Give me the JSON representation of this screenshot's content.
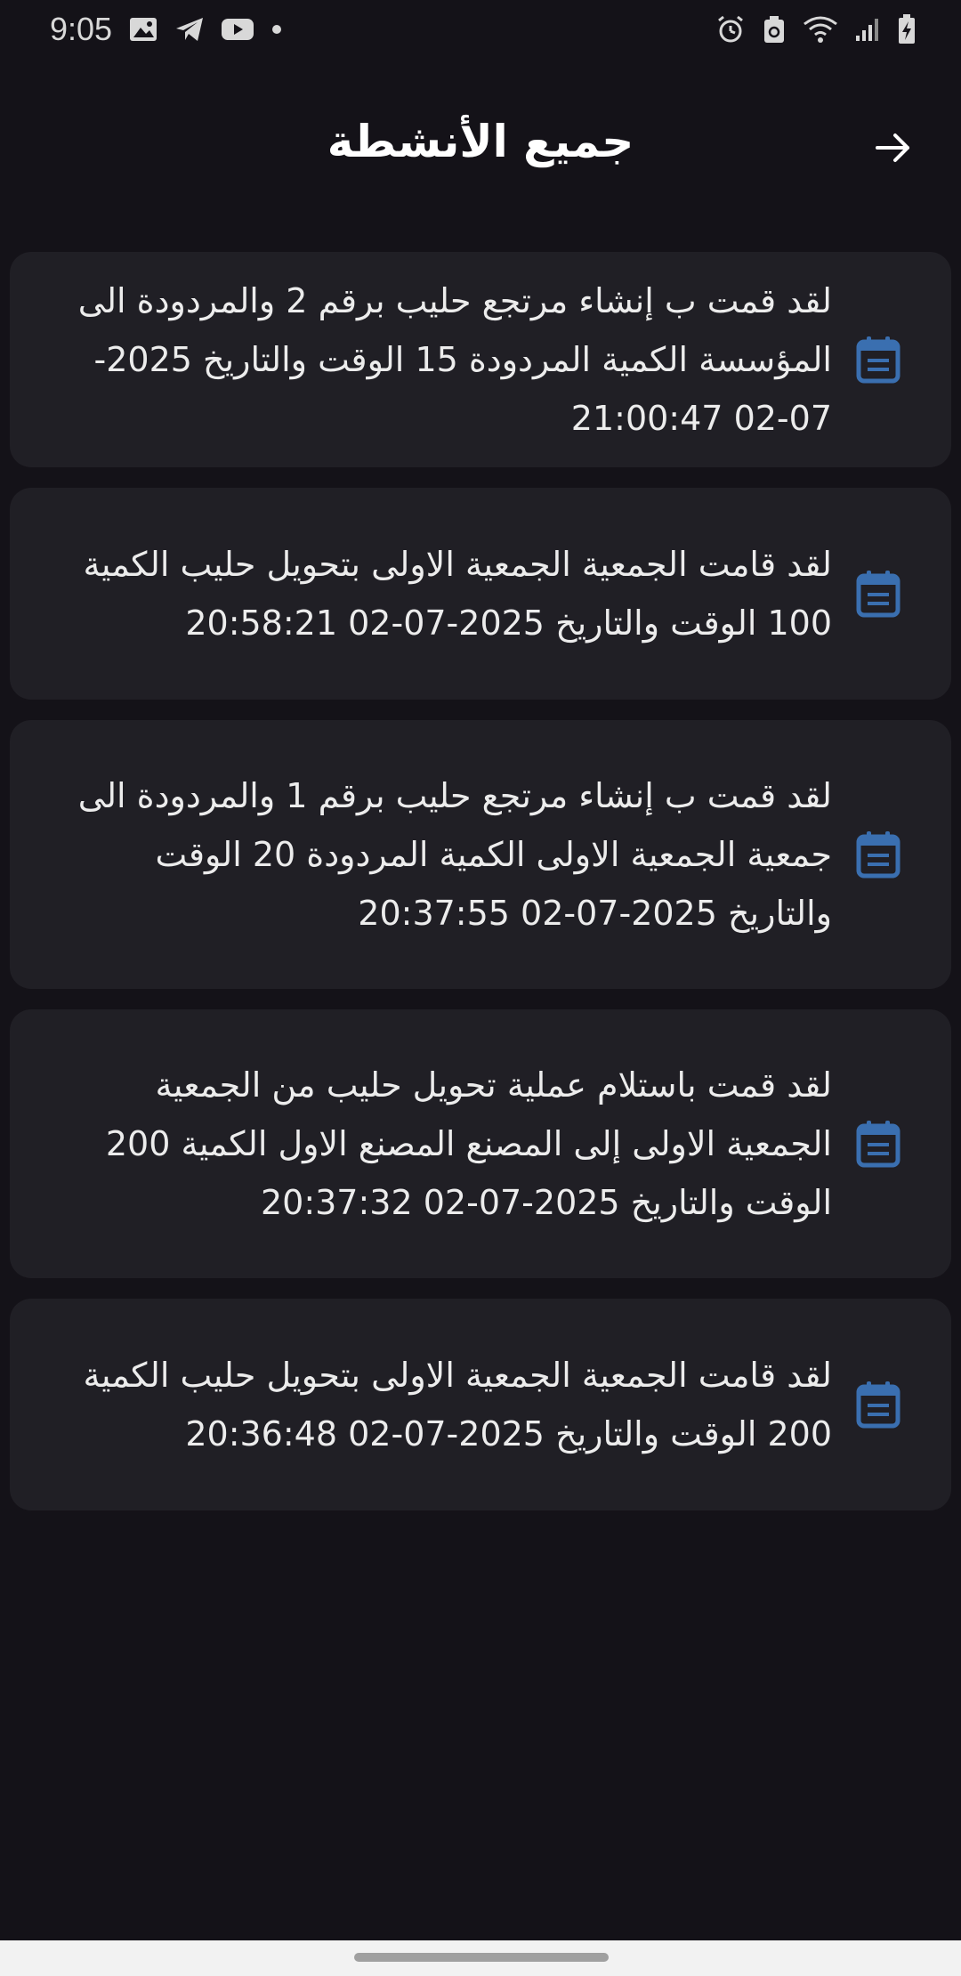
{
  "status_bar": {
    "time": "9:05",
    "left_icons": [
      "image-icon",
      "telegram-icon",
      "youtube-icon",
      "notification-dot-icon"
    ],
    "right_icons": [
      "alarm-icon",
      "recycle-icon",
      "wifi-icon",
      "signal-icon",
      "battery-charging-icon"
    ]
  },
  "header": {
    "title": "جميع الأنشطة",
    "back_icon": "arrow-right-icon"
  },
  "colors": {
    "background": "#141218",
    "card": "#201f25",
    "icon_accent": "#3a6fb0",
    "text": "#ececec"
  },
  "activities": [
    {
      "icon": "calendar-icon",
      "text": "لقد قمت ب إنشاء مرتجع حليب برقم 2 والمردودة الى المؤسسة الكمية المردودة 15 الوقت والتاريخ 2025-07-02 21:00:47"
    },
    {
      "icon": "calendar-icon",
      "text": "لقد قامت الجمعية الجمعية الاولى بتحويل حليب  الكمية 100 الوقت والتاريخ 2025-07-02 20:58:21"
    },
    {
      "icon": "calendar-icon",
      "text": "لقد قمت ب إنشاء مرتجع حليب برقم 1 والمردودة الى جمعية الجمعية الاولى الكمية المردودة 20 الوقت والتاريخ 2025-07-02 20:37:55"
    },
    {
      "icon": "calendar-icon",
      "text": "لقد قمت باستلام عملية تحويل حليب من الجمعية الجمعية الاولى إلى المصنع المصنع الاول الكمية 200 الوقت والتاريخ 2025-07-02 20:37:32"
    },
    {
      "icon": "calendar-icon",
      "text": "لقد قامت الجمعية الجمعية الاولى بتحويل حليب  الكمية 200 الوقت والتاريخ 2025-07-02 20:36:48"
    }
  ]
}
